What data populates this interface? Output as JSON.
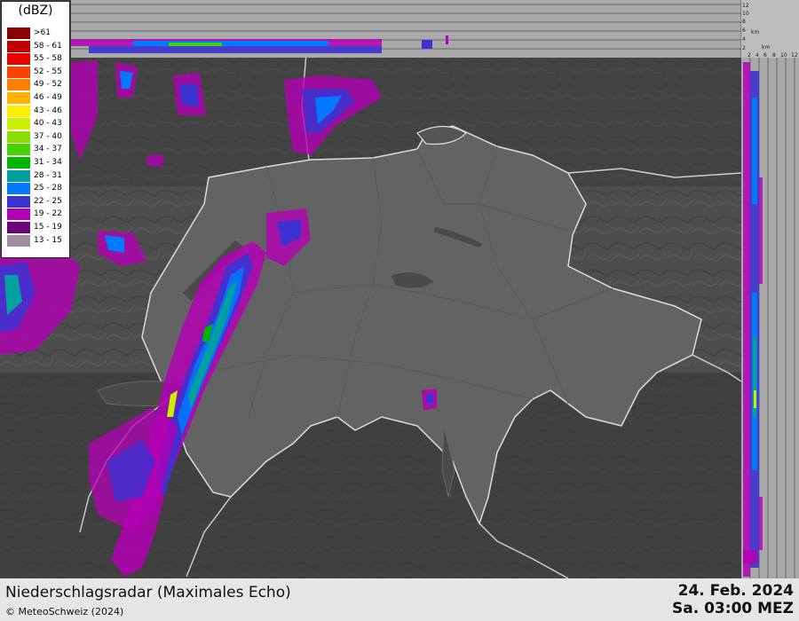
{
  "legend": {
    "title": "(dBZ)",
    "items": [
      {
        "label": ">61",
        "color": "#8b0000"
      },
      {
        "label": "58 - 61",
        "color": "#c00000"
      },
      {
        "label": "55 - 58",
        "color": "#e60000"
      },
      {
        "label": "52 - 55",
        "color": "#ff4000"
      },
      {
        "label": "49 - 52",
        "color": "#ff8000"
      },
      {
        "label": "46 - 49",
        "color": "#ffb000"
      },
      {
        "label": "43 - 46",
        "color": "#ffee00"
      },
      {
        "label": "40 - 43",
        "color": "#c8f000"
      },
      {
        "label": "37 - 40",
        "color": "#8cdc00"
      },
      {
        "label": "34 - 37",
        "color": "#46d200"
      },
      {
        "label": "31 - 34",
        "color": "#00b400"
      },
      {
        "label": "28 - 31",
        "color": "#00a0a0"
      },
      {
        "label": "25 - 28",
        "color": "#0078ff"
      },
      {
        "label": "22 - 25",
        "color": "#3c32d2"
      },
      {
        "label": "19 - 22",
        "color": "#b400b4"
      },
      {
        "label": "15 - 19",
        "color": "#6e0078"
      },
      {
        "label": "13 - 15",
        "color": "#a08ca0"
      }
    ]
  },
  "side_scale": {
    "ticks": [
      "12",
      "10",
      "8",
      "6",
      "4",
      "2"
    ],
    "unit": "km",
    "x_ticks": [
      "2",
      "4",
      "6",
      "8",
      "10",
      "12"
    ]
  },
  "footer": {
    "product_title": "Niederschlagsradar (Maximales Echo)",
    "copyright": "© MeteoSchweiz (2024)",
    "date": "24. Feb. 2024",
    "time": "Sa. 03:00 MEZ"
  }
}
